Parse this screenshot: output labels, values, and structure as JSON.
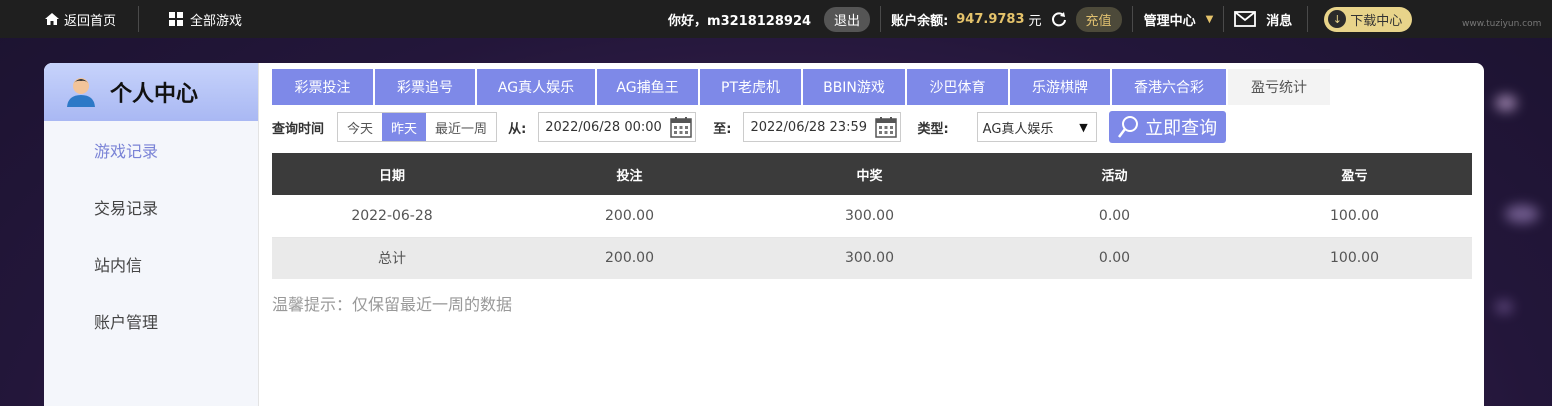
{
  "topbar": {
    "home_label": "返回首页",
    "all_games_label": "全部游戏",
    "greeting": "你好，m3218128924",
    "logout_label": "退出",
    "balance_label": "账户余额:",
    "balance_value": "947.9783",
    "balance_unit": "元",
    "recharge_label": "充值",
    "management_label": "管理中心",
    "messages_label": "消息",
    "download_label": "下载中心"
  },
  "watermark": "www.tuziyun.com",
  "sidebar": {
    "title": "个人中心",
    "items": [
      {
        "label": "游戏记录"
      },
      {
        "label": "交易记录"
      },
      {
        "label": "站内信"
      },
      {
        "label": "账户管理"
      }
    ]
  },
  "tabs": [
    {
      "label": "彩票投注"
    },
    {
      "label": "彩票追号"
    },
    {
      "label": "AG真人娱乐"
    },
    {
      "label": "AG捕鱼王"
    },
    {
      "label": "PT老虎机"
    },
    {
      "label": "BBIN游戏"
    },
    {
      "label": "沙巴体育"
    },
    {
      "label": "乐游棋牌"
    },
    {
      "label": "香港六合彩"
    },
    {
      "label": "盈亏统计"
    }
  ],
  "query": {
    "time_label": "查询时间",
    "today": "今天",
    "yesterday": "昨天",
    "last_week": "最近一周",
    "from_label": "从:",
    "from_value": "2022/06/28 00:00",
    "to_label": "至:",
    "to_value": "2022/06/28 23:59",
    "type_label": "类型:",
    "type_value": "AG真人娱乐",
    "search_label": "立即查询"
  },
  "table": {
    "headers": [
      "日期",
      "投注",
      "中奖",
      "活动",
      "盈亏"
    ],
    "rows": [
      [
        "2022-06-28",
        "200.00",
        "300.00",
        "0.00",
        "100.00"
      ],
      [
        "总计",
        "200.00",
        "300.00",
        "0.00",
        "100.00"
      ]
    ]
  },
  "tip": "温馨提示：仅保留最近一周的数据",
  "colors": {
    "accent": "#7e89e8",
    "topbar": "#1f1f1f",
    "gold": "#e5c36b"
  }
}
